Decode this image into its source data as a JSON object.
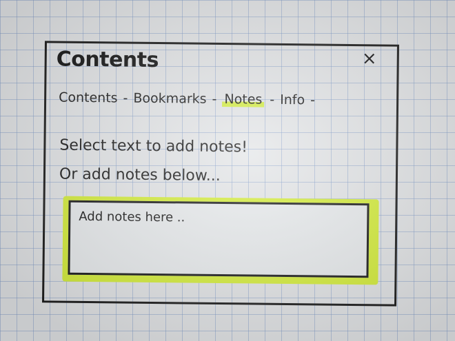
{
  "panel": {
    "title": "Contents",
    "close_icon": "close-icon",
    "close_label": "×"
  },
  "tabs": [
    {
      "label": "Contents",
      "active": false
    },
    {
      "label": "Bookmarks",
      "active": false
    },
    {
      "label": "Notes",
      "active": true
    },
    {
      "label": "Info",
      "active": false
    }
  ],
  "separator": "-",
  "instructions": {
    "line1": "Select text to add notes!",
    "line2": "Or add notes below..."
  },
  "notes_field": {
    "placeholder": "Add notes here ..",
    "value": ""
  },
  "colors": {
    "highlight": "#d6ef3a",
    "ink": "#1a1a1a"
  }
}
